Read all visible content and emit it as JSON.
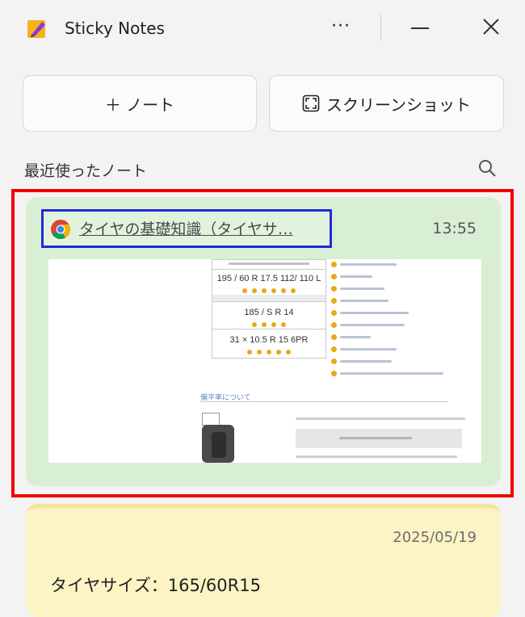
{
  "window": {
    "title": "Sticky Notes",
    "more_label": "···"
  },
  "toolbar": {
    "new_note_label": "＋ ノート",
    "screenshot_label": "スクリーンショット"
  },
  "recent_section": {
    "label": "最近使ったノート"
  },
  "notes": [
    {
      "type": "web-clip",
      "link_text": "タイヤの基礎知識（タイヤサ…",
      "time": "13:55",
      "color": "#d9efd4",
      "preview": {
        "rows": [
          {
            "text": "195 / 60 R 17.5 112/ 110 L",
            "dots": 6
          },
          {
            "text": "185 / S R 14",
            "dots": 4
          },
          {
            "text": "31 × 10.5 R 15 6PR",
            "dots": 5
          }
        ],
        "section_heading": "偏平率について",
        "dot_color": "#e8a81b"
      }
    },
    {
      "type": "text",
      "date": "2025/05/19",
      "body": "タイヤサイズ：165/60R15",
      "color": "#fdf4c6"
    }
  ],
  "annotations": {
    "outer_highlight_color": "#f00000",
    "link_highlight_color": "#1f2bdb"
  }
}
